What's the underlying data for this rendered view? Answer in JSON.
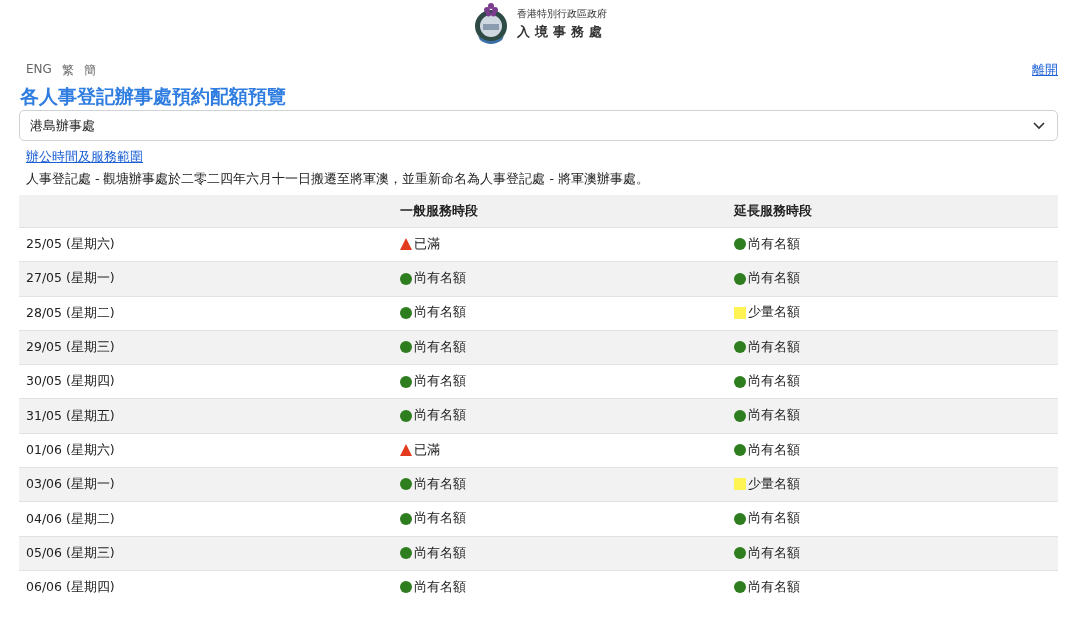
{
  "header": {
    "org_line": "香港特別行政區政府",
    "dept_line": "入境事務處"
  },
  "languages": [
    "ENG",
    "繁",
    "簡"
  ],
  "logout": "離開",
  "title": "各人事登記辦事處預約配額預覽",
  "office_select": {
    "value": "港島辦事處"
  },
  "hours_link": "辦公時間及服務範圍",
  "notice": "人事登記處 - 觀塘辦事處於二零二四年六月十一日搬遷至將軍澳，並重新命名為人事登記處 - 將軍澳辦事處。",
  "table": {
    "columns": [
      "一般服務時段",
      "延長服務時段"
    ],
    "rows": [
      {
        "date": "25/05 (星期六)",
        "slots": [
          {
            "kind": "full",
            "text": "已滿"
          },
          {
            "kind": "available",
            "text": "尚有名額"
          }
        ]
      },
      {
        "date": "27/05 (星期一)",
        "slots": [
          {
            "kind": "available",
            "text": "尚有名額"
          },
          {
            "kind": "available",
            "text": "尚有名額"
          }
        ]
      },
      {
        "date": "28/05 (星期二)",
        "slots": [
          {
            "kind": "available",
            "text": "尚有名額"
          },
          {
            "kind": "limited",
            "text": "少量名額"
          }
        ]
      },
      {
        "date": "29/05 (星期三)",
        "slots": [
          {
            "kind": "available",
            "text": "尚有名額"
          },
          {
            "kind": "available",
            "text": "尚有名額"
          }
        ]
      },
      {
        "date": "30/05 (星期四)",
        "slots": [
          {
            "kind": "available",
            "text": "尚有名額"
          },
          {
            "kind": "available",
            "text": "尚有名額"
          }
        ]
      },
      {
        "date": "31/05 (星期五)",
        "slots": [
          {
            "kind": "available",
            "text": "尚有名額"
          },
          {
            "kind": "available",
            "text": "尚有名額"
          }
        ]
      },
      {
        "date": "01/06 (星期六)",
        "slots": [
          {
            "kind": "full",
            "text": "已滿"
          },
          {
            "kind": "available",
            "text": "尚有名額"
          }
        ]
      },
      {
        "date": "03/06 (星期一)",
        "slots": [
          {
            "kind": "available",
            "text": "尚有名額"
          },
          {
            "kind": "limited",
            "text": "少量名額"
          }
        ]
      },
      {
        "date": "04/06 (星期二)",
        "slots": [
          {
            "kind": "available",
            "text": "尚有名額"
          },
          {
            "kind": "available",
            "text": "尚有名額"
          }
        ]
      },
      {
        "date": "05/06 (星期三)",
        "slots": [
          {
            "kind": "available",
            "text": "尚有名額"
          },
          {
            "kind": "available",
            "text": "尚有名額"
          }
        ]
      },
      {
        "date": "06/06 (星期四)",
        "slots": [
          {
            "kind": "available",
            "text": "尚有名額"
          },
          {
            "kind": "available",
            "text": "尚有名額"
          }
        ]
      }
    ]
  }
}
